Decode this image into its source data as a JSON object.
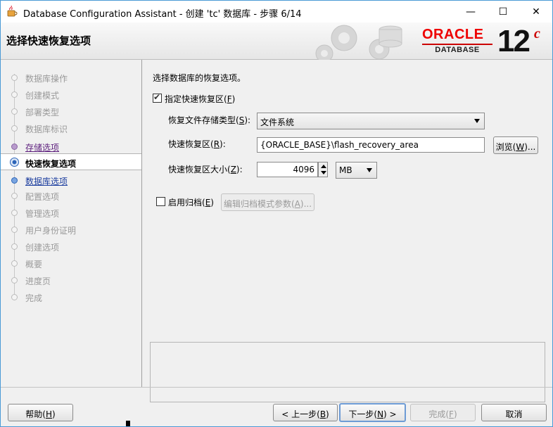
{
  "window": {
    "title": "Database Configuration Assistant - 创建 'tc' 数据库 - 步骤 6/14",
    "minimize": "—",
    "maximize": "☐",
    "close": "✕"
  },
  "banner": {
    "title": "选择快速恢复选项",
    "logo_oracle": "ORACLE",
    "logo_database": "DATABASE",
    "logo_version": "12",
    "logo_version_suffix": "c"
  },
  "nav": {
    "items": [
      {
        "label": "数据库操作",
        "state": "pending"
      },
      {
        "label": "创建模式",
        "state": "pending"
      },
      {
        "label": "部署类型",
        "state": "pending"
      },
      {
        "label": "数据库标识",
        "state": "pending"
      },
      {
        "label": "存储选项",
        "state": "done"
      },
      {
        "label": "快速恢复选项",
        "state": "active"
      },
      {
        "label": "数据库选项",
        "state": "next"
      },
      {
        "label": "配置选项",
        "state": "pending"
      },
      {
        "label": "管理选项",
        "state": "pending"
      },
      {
        "label": "用户身份证明",
        "state": "pending"
      },
      {
        "label": "创建选项",
        "state": "pending"
      },
      {
        "label": "概要",
        "state": "pending"
      },
      {
        "label": "进度页",
        "state": "pending"
      },
      {
        "label": "完成",
        "state": "pending"
      }
    ]
  },
  "form": {
    "heading": "选择数据库的恢复选项。",
    "fra_checkbox": {
      "label_pre": "指定快速恢复区(",
      "mnemonic": "F",
      "label_post": ")",
      "checked": true
    },
    "storage_type": {
      "label_pre": "恢复文件存储类型(",
      "mnemonic": "S",
      "label_post": "):",
      "value": "文件系统"
    },
    "fra_location": {
      "label_pre": "快速恢复区(",
      "mnemonic": "R",
      "label_post": "):",
      "value": "{ORACLE_BASE}\\flash_recovery_area"
    },
    "browse_button": {
      "label_pre": "浏览(",
      "mnemonic": "W",
      "label_post": ")..."
    },
    "fra_size": {
      "label_pre": "快速恢复区大小(",
      "mnemonic": "Z",
      "label_post": "):",
      "value": "4096",
      "unit": "MB"
    },
    "archive_checkbox": {
      "label_pre": "启用归档(",
      "mnemonic": "E",
      "label_post": ")",
      "checked": false
    },
    "edit_archive_button": {
      "label_pre": "编辑归档模式参数(",
      "mnemonic": "A",
      "label_post": ")..."
    }
  },
  "footer": {
    "help": {
      "label_pre": "帮助(",
      "mnemonic": "H",
      "label_post": ")"
    },
    "back": {
      "label_pre": "< 上一步(",
      "mnemonic": "B",
      "label_post": ")"
    },
    "next": {
      "label_pre": "下一步(",
      "mnemonic": "N",
      "label_post": ") >"
    },
    "finish": {
      "label_pre": "完成(",
      "mnemonic": "F",
      "label_post": ")"
    },
    "cancel": "取消"
  }
}
